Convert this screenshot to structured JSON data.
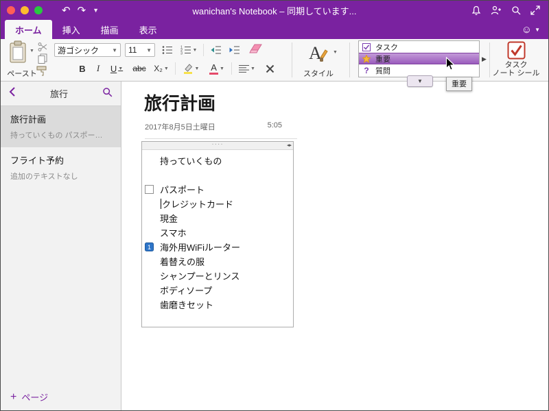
{
  "colors": {
    "accent_purple": "#7a22a0",
    "tag_selection_purple": "#9a5cbd",
    "star_yellow": "#f6b73c",
    "task_seal_red": "#c0392b",
    "traffic_red": "#ff5f57",
    "traffic_yellow": "#febc2e",
    "traffic_green": "#28c840"
  },
  "titlebar": {
    "title": "wanichan's Notebook – 同期しています..."
  },
  "tabs": [
    {
      "label": "ホーム"
    },
    {
      "label": "挿入"
    },
    {
      "label": "描画"
    },
    {
      "label": "表示"
    }
  ],
  "ribbon": {
    "paste_label": "ペースト",
    "font_name": "游ゴシック",
    "font_size": "11",
    "format": {
      "bold": "B",
      "italic": "I",
      "underline": "U",
      "strikethrough": "abc",
      "subscript": "X₂",
      "font_color_letter": "A"
    },
    "style_label": "スタイル",
    "tags": [
      {
        "label": "タスク",
        "icon": "checkbox-icon"
      },
      {
        "label": "重要",
        "icon": "star-icon",
        "selected": true
      },
      {
        "label": "質問",
        "icon": "question-icon"
      }
    ],
    "tooltip": "重要",
    "task_seal_label_1": "タスク",
    "task_seal_label_2": "ノート シール"
  },
  "sidebar": {
    "section_title": "旅行",
    "pages": [
      {
        "title": "旅行計画",
        "subtitle": "持っていくもの パスポー…",
        "selected": true
      },
      {
        "title": "フライト予約",
        "subtitle": "追加のテキストなし",
        "selected": false
      }
    ],
    "add_page_label": "ページ",
    "add_page_plus": "+"
  },
  "main": {
    "page_title": "旅行計画",
    "date": "2017年8月5日土曜日",
    "time": "5:05",
    "note": {
      "heading": "持っていくもの",
      "items": [
        {
          "text": "パスポート",
          "marker": "checkbox"
        },
        {
          "text": "クレジットカード",
          "caret": true
        },
        {
          "text": "現金"
        },
        {
          "text": "スマホ"
        },
        {
          "text": "海外用WiFiルーター",
          "marker": "blue-tag"
        },
        {
          "text": "着替えの服"
        },
        {
          "text": "シャンプーとリンス"
        },
        {
          "text": "ボディソープ"
        },
        {
          "text": "歯磨きセット"
        }
      ]
    }
  }
}
